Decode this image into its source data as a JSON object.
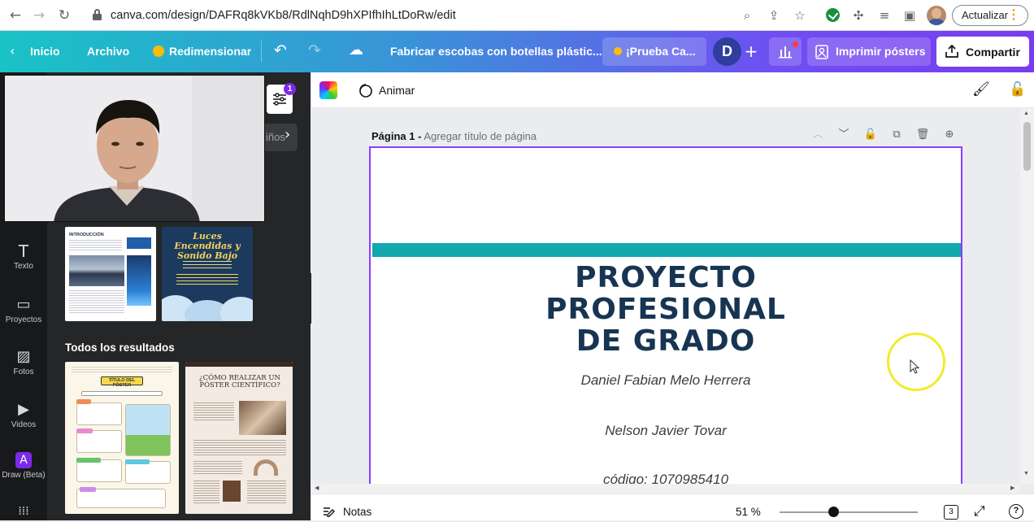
{
  "browser": {
    "url": "canva.com/design/DAFRq8kVKb8/RdlNqhD9hXPIfhIhLtDoRw/edit",
    "update_label": "Actualizar"
  },
  "header": {
    "home_label": "Inicio",
    "file_label": "Archivo",
    "resize_label": "Redimensionar",
    "doc_title": "Fabricar escobas con botellas plástic...",
    "try_label": "¡Prueba Ca...",
    "user_initial": "D",
    "print_label": "Imprimir pósters",
    "share_label": "Compartir"
  },
  "rail": {
    "items": [
      {
        "label": "Texto",
        "icon": "text-icon"
      },
      {
        "label": "Proyectos",
        "icon": "folder-icon"
      },
      {
        "label": "Fotos",
        "icon": "photo-icon"
      },
      {
        "label": "Videos",
        "icon": "video-icon"
      },
      {
        "label": "Draw (Beta)",
        "icon": "draw-icon"
      }
    ]
  },
  "panel": {
    "filter_count": "1",
    "chip_partial": "iños",
    "results_heading": "Todos los resultados",
    "templates": {
      "intro_heading": "INTRODUCCIÓN",
      "event_title": "Luces Encendidas y Sonido Bajo",
      "poster_title_label": "TÍTULO DEL PÓSTER",
      "science_title": "¿CÓMO REALIZAR UN PÓSTER CIENTÍFICO?"
    }
  },
  "toolbar": {
    "animate_label": "Animar"
  },
  "page": {
    "label_bold": "Página 1 -",
    "label_hint": "Agregar título de página"
  },
  "poster": {
    "title_line1": "PROYECTO",
    "title_line2": "PROFESIONAL",
    "title_line3": "DE GRADO",
    "author1": "Daniel Fabian Melo Herrera",
    "author2": "Nelson Javier Tovar",
    "code": "código: 1070985410"
  },
  "bottom": {
    "notes_label": "Notas",
    "zoom": "51 %",
    "zoom_fraction": 0.39,
    "page_count": "3"
  },
  "colors": {
    "accent": "#8b3dff",
    "teal": "#12a8ae",
    "title_navy": "#173553"
  }
}
